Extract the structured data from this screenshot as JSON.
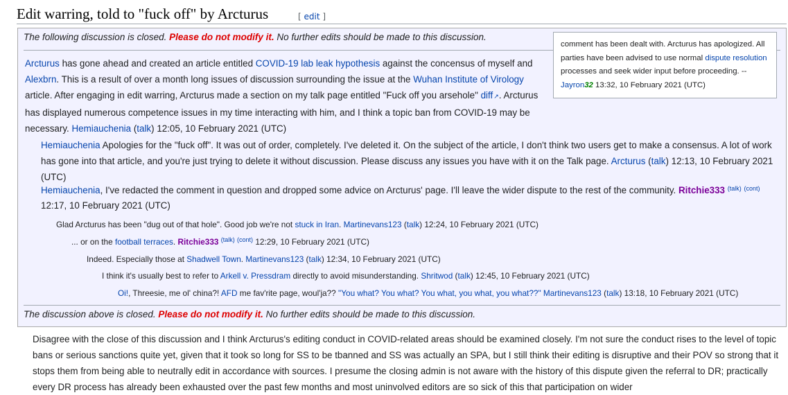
{
  "section": {
    "title": "Edit warring, told to \"fuck off\" by Arcturus",
    "edit_open": "[ ",
    "edit_link": "edit",
    "edit_close": " ]"
  },
  "banner": {
    "pre_top": "The following discussion is closed. ",
    "pre_bottom": "The discussion above is closed. ",
    "warning": "Please do not modify it.",
    "post": " No further edits should be made to this discussion."
  },
  "close_note": {
    "t1": "comment has been dealt with. Arcturus has apologized. All parties have been advised to use normal ",
    "link": "dispute resolution",
    "t2": " processes and seek wider input before proceeding. --",
    "sig_name": "Jayron",
    "sig_num": "32",
    "t3": " 13:32, 10 February 2021 (UTC)"
  },
  "posts": {
    "p1": {
      "u1": "Arcturus",
      "t1": " has gone ahead and created an article entitled ",
      "l1": "COVID-19 lab leak hypothesis",
      "t2": " against the concensus of myself and ",
      "u2": "Alexbrn",
      "t3": ". This is a result of over a month long issues of discussion surrounding the issue at the ",
      "l2": "Wuhan Institute of Virology",
      "t4": " article. After engaging in edit warring, Arcturus made a section on my talk page entitled \"Fuck off you arsehole\" ",
      "diff": "diff",
      "t5": ". Arcturus has displayed numerous competence issues in my time interacting with him, and I think a topic ban from COVID-19 may be necessary. ",
      "sig": "Hemiauchenia",
      "talk": "talk",
      "ts": " 12:05, 10 February 2021 (UTC)"
    },
    "p2": {
      "u1": "Hemiauchenia",
      "t1": " Apologies for the \"fuck off\". It was out of order, completely. I've deleted it. On the subject of the article, I don't think two users get to make a consensus. A lot of work has gone into that article, and you're just trying to delete it without discussion. Please discuss any issues you have with it on the Talk page. ",
      "sig": "Arcturus",
      "talk": "talk",
      "ts": " 12:13, 10 February 2021 (UTC)"
    },
    "p3": {
      "u1": "Hemiauchenia",
      "t1": ", I've redacted the comment in question and dropped some advice on Arcturus' page. I'll leave the wider dispute to the rest of the community. ",
      "sig": "Ritchie333",
      "talk": "(talk)",
      "cont": "(cont)",
      "ts": " 12:17, 10 February 2021 (UTC)"
    },
    "p4": {
      "t1": "Glad Arcturus has been \"dug out of that hole\". Good job we're not ",
      "l1": "stuck in Iran",
      "t2": ". ",
      "sig": "Martinevans123",
      "talk": "talk",
      "ts": " 12:24, 10 February 2021 (UTC)"
    },
    "p5": {
      "t1": "... or on the ",
      "l1": "football terraces",
      "t2": ". ",
      "sig": "Ritchie333",
      "talk": "(talk)",
      "cont": "(cont)",
      "ts": " 12:29, 10 February 2021 (UTC)"
    },
    "p6": {
      "t1": "Indeed. Especially those at ",
      "l1": "Shadwell Town",
      "t2": ". ",
      "sig": "Martinevans123",
      "talk": "talk",
      "ts": " 12:34, 10 February 2021 (UTC)"
    },
    "p7": {
      "t1": "I think it's usually best to refer to ",
      "l1": "Arkell v. Pressdram",
      "t2": " directly to avoid misunderstanding. ",
      "sig": "Shritwod",
      "talk": "talk",
      "ts": " 12:45, 10 February 2021 (UTC)"
    },
    "p8": {
      "l1": "Oi!",
      "t1": ", Threesie, me ol' china?! ",
      "l2": "AFD",
      "t2": " me fav'rite page, woul'ja?? ",
      "l3": "\"You what? You what? You what, you what, you what??\"",
      "t3": " ",
      "sig": "Martinevans123",
      "talk": "talk",
      "ts": " 13:18, 10 February 2021 (UTC)"
    }
  },
  "after_close": {
    "text": "Disagree with the close of this discussion and I think Arcturus's editing conduct in COVID-related areas should be examined closely. I'm not sure the conduct rises to the level of topic bans or serious sanctions quite yet, given that it took so long for SS to be tbanned and SS was actually an SPA, but I still think their editing is disruptive and their POV so strong that it stops them from being able to neutrally edit in accordance with sources. I presume the closing admin is not aware with the history of this dispute given the referral to DR; practically every DR process has already been exhausted over the past few months and most uninvolved editors are so sick of this that participation on wider"
  }
}
